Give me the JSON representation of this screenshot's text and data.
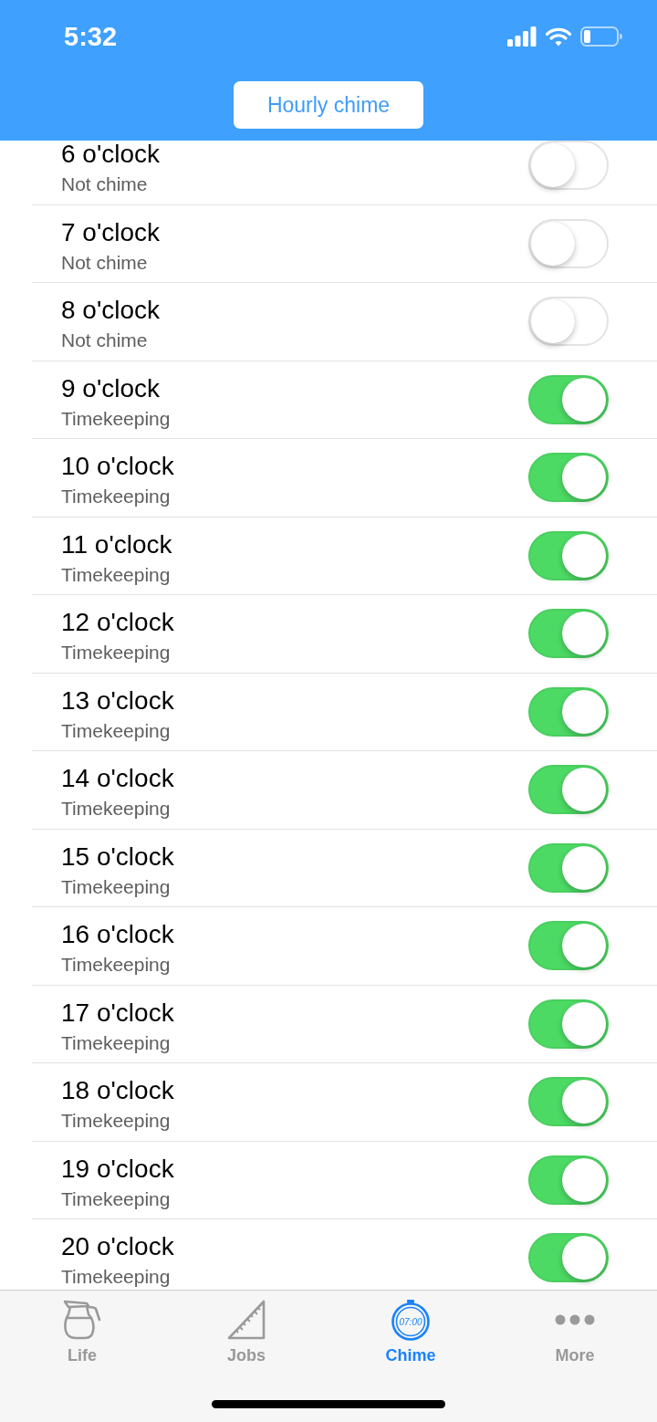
{
  "status_bar": {
    "time": "5:32"
  },
  "header": {
    "title": "Hourly chime"
  },
  "hours": [
    {
      "label": "6 o'clock",
      "status": "Not chime",
      "on": false
    },
    {
      "label": "7 o'clock",
      "status": "Not chime",
      "on": false
    },
    {
      "label": "8 o'clock",
      "status": "Not chime",
      "on": false
    },
    {
      "label": "9 o'clock",
      "status": "Timekeeping",
      "on": true
    },
    {
      "label": "10 o'clock",
      "status": "Timekeeping",
      "on": true
    },
    {
      "label": "11 o'clock",
      "status": "Timekeeping",
      "on": true
    },
    {
      "label": "12 o'clock",
      "status": "Timekeeping",
      "on": true
    },
    {
      "label": "13 o'clock",
      "status": "Timekeeping",
      "on": true
    },
    {
      "label": "14 o'clock",
      "status": "Timekeeping",
      "on": true
    },
    {
      "label": "15 o'clock",
      "status": "Timekeeping",
      "on": true
    },
    {
      "label": "16 o'clock",
      "status": "Timekeeping",
      "on": true
    },
    {
      "label": "17 o'clock",
      "status": "Timekeeping",
      "on": true
    },
    {
      "label": "18 o'clock",
      "status": "Timekeeping",
      "on": true
    },
    {
      "label": "19 o'clock",
      "status": "Timekeeping",
      "on": true
    },
    {
      "label": "20 o'clock",
      "status": "Timekeeping",
      "on": true
    }
  ],
  "tab_bar": [
    {
      "label": "Life",
      "selected": false
    },
    {
      "label": "Jobs",
      "selected": false
    },
    {
      "label": "Chime",
      "selected": true,
      "icon_text": "07:00"
    },
    {
      "label": "More",
      "selected": false
    }
  ]
}
